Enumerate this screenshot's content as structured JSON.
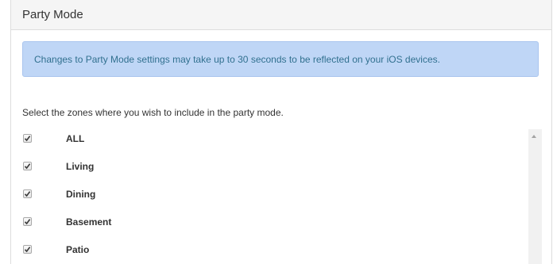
{
  "panel": {
    "title": "Party Mode"
  },
  "alert": {
    "text": "Changes to Party Mode settings may take up to 30 seconds to be reflected on your iOS devices."
  },
  "instructions": "Select the zones where you wish to include in the party mode.",
  "zones": [
    {
      "label": "ALL",
      "checked": true
    },
    {
      "label": "Living",
      "checked": true
    },
    {
      "label": "Dining",
      "checked": true
    },
    {
      "label": "Basement",
      "checked": true
    },
    {
      "label": "Patio",
      "checked": true
    }
  ],
  "icons": {
    "checkmark": "checkmark-icon",
    "scroll_up": "chevron-up-icon"
  },
  "colors": {
    "alert_background": "#bfd6f6",
    "alert_text": "#31708f",
    "heading_background": "#f5f5f5"
  }
}
